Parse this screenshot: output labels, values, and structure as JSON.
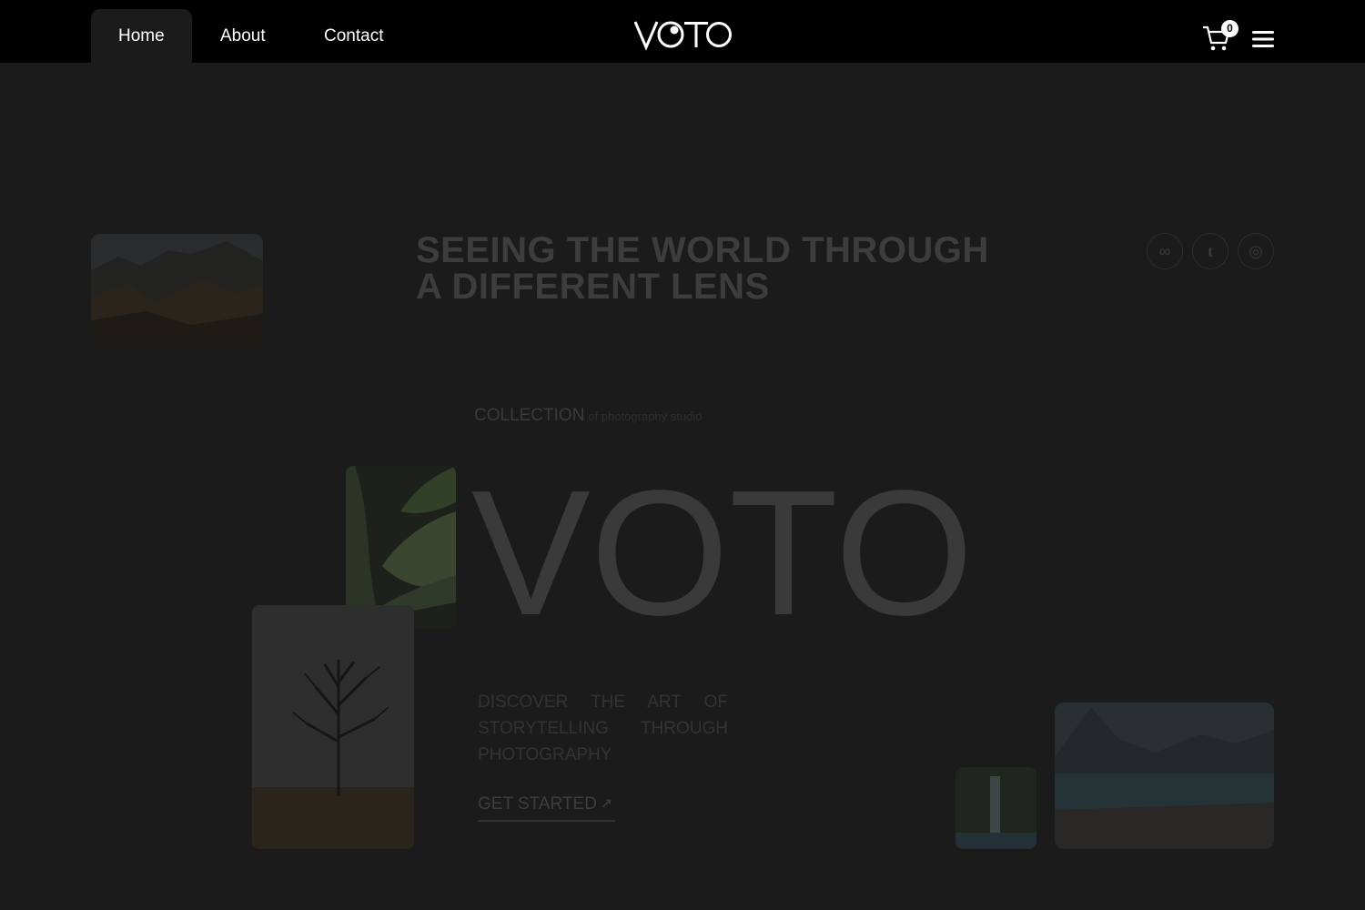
{
  "nav": {
    "items": [
      {
        "label": "Home",
        "active": true
      },
      {
        "label": "About",
        "active": false
      },
      {
        "label": "Contact",
        "active": false
      }
    ]
  },
  "brand": {
    "logo_text": "VOTO"
  },
  "cart": {
    "count": "0"
  },
  "hero": {
    "headline_line1": "SEEING THE WORLD THROUGH",
    "headline_line2": "A DIFFERENT LENS",
    "collection_label": "COLLECTION",
    "collection_sub": "of photography studio",
    "big_word": "VOTO",
    "tagline": "DISCOVER THE ART OF STORYTELLING THROUGH PHOTOGRAPHY",
    "cta_label": "GET STARTED",
    "cta_arrow": "↗"
  },
  "social": [
    {
      "name": "meta-icon",
      "glyph": "∞"
    },
    {
      "name": "tumblr-icon",
      "glyph": "t"
    },
    {
      "name": "dribbble-icon",
      "glyph": "◎"
    }
  ],
  "colors": {
    "header_bg": "#000000",
    "page_bg": "#1b1b1b",
    "muted_text": "#3a3a3a",
    "white": "#ffffff"
  }
}
